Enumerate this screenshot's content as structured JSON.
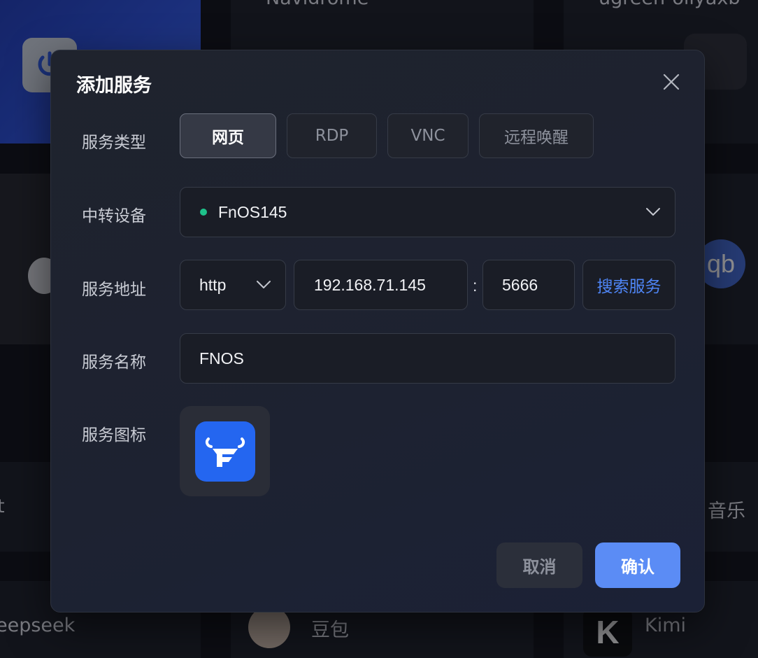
{
  "background": {
    "top_labels": [
      "Navidrome",
      "ugreen-ollyaxb"
    ],
    "right_icon_text": "qb",
    "left_partial_text": "t",
    "right_music_label": "音乐",
    "bottom_labels": [
      "eepseek",
      "豆包",
      "Kimi"
    ]
  },
  "dialog": {
    "title": "添加服务",
    "close_icon": "close-icon",
    "service_type": {
      "label": "服务类型",
      "options": [
        "网页",
        "RDP",
        "VNC",
        "远程唤醒"
      ],
      "selected": "网页"
    },
    "relay_device": {
      "label": "中转设备",
      "value": "FnOS145",
      "status_color": "#1ec28b"
    },
    "service_address": {
      "label": "服务地址",
      "protocol": "http",
      "host": "192.168.71.145",
      "separator": ":",
      "port": "5666",
      "search_button": "搜索服务"
    },
    "service_name": {
      "label": "服务名称",
      "value": "FNOS"
    },
    "service_icon": {
      "label": "服务图标",
      "icon": "fnos-logo-icon",
      "icon_color": "#2466f0"
    },
    "buttons": {
      "cancel": "取消",
      "confirm": "确认"
    }
  },
  "colors": {
    "accent": "#5b8cf5",
    "link": "#4f86f7"
  }
}
